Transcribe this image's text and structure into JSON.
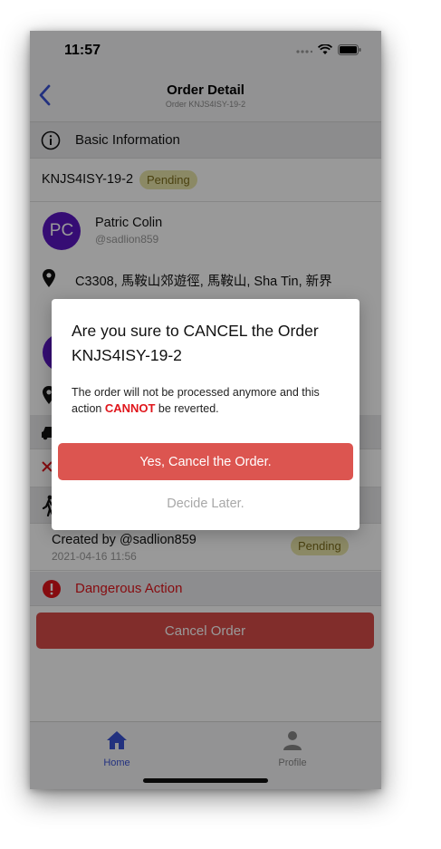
{
  "status_bar": {
    "time": "11:57"
  },
  "nav": {
    "title": "Order Detail",
    "subtitle": "Order KNJS4ISY-19-2"
  },
  "basic_info": {
    "section_label": "Basic Information",
    "order_id": "KNJS4ISY-19-2",
    "status": "Pending",
    "customer_initials": "PC",
    "customer_name": "Patric Colin",
    "customer_handle": "@sadlion859",
    "address": "C3308, 馬鞍山郊遊徑, 馬鞍山, Sha Tin, 新界"
  },
  "history": {
    "created_by": "Created by @sadlion859",
    "created_at": "2021-04-16 11:56",
    "status": "Pending"
  },
  "danger": {
    "section_label": "Dangerous Action",
    "button_label": "Cancel Order"
  },
  "dialog": {
    "title": "Are you sure to CANCEL the Order KNJS4ISY-19-2",
    "body_prefix": "The order will not be processed anymore and this action ",
    "body_emphasis": "CANNOT",
    "body_suffix": " be reverted.",
    "confirm_label": "Yes, Cancel the Order.",
    "later_label": "Decide Later."
  },
  "tabs": [
    {
      "label": "Home",
      "icon": "home-icon",
      "active": true
    },
    {
      "label": "Profile",
      "icon": "person-icon",
      "active": false
    }
  ],
  "colors": {
    "accent": "#3a52d4",
    "danger": "#d84b48",
    "pending": "#e8e5a8"
  }
}
